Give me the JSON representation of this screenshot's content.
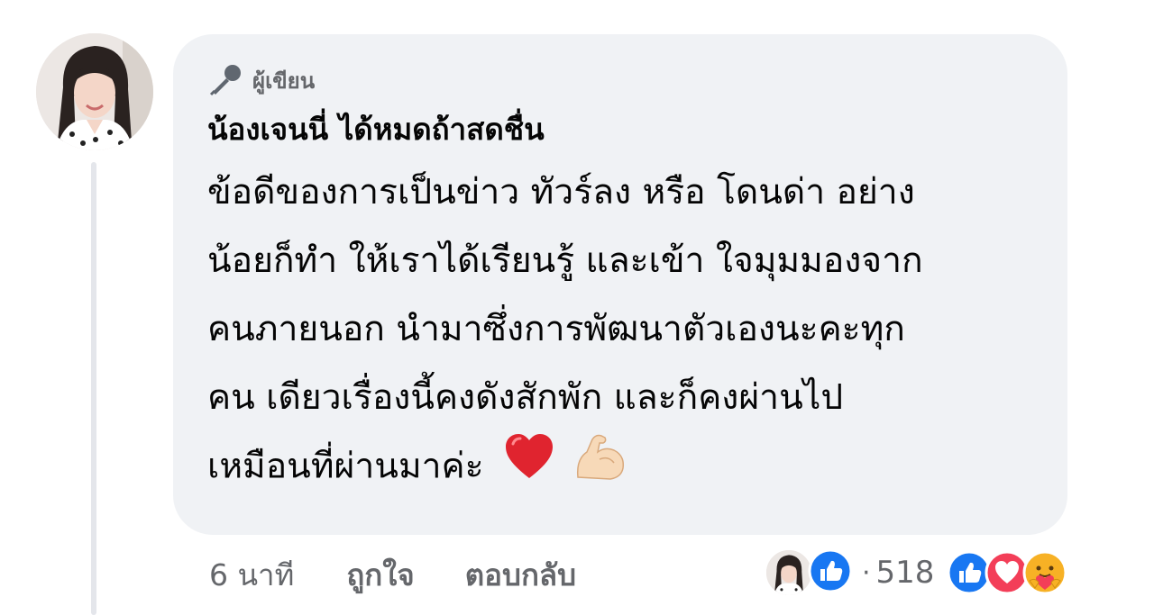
{
  "comment": {
    "badge_label": "ผู้เขียน",
    "badge_icon": "microphone-icon",
    "author_name": "น้องเจนนี่ ได้หมดถ้าสดชื่น",
    "text_lines": [
      "ข้อดีของการเป็นข่าว ทัวร์ลง หรือ โดนด่า อย่าง",
      "น้อยก็ทำ ให้เราได้เรียนรู้ และเข้า ใจมุมมองจาก",
      "คนภายนอก นำมาซึ่งการพัฒนาตัวเองนะคะทุก",
      "คน เดียวเรื่องนี้คงดังสักพัก และก็คงผ่านไป",
      "เหมือนที่ผ่านมาค่ะ"
    ],
    "emojis": [
      "red-heart-emoji",
      "flexed-biceps-emoji"
    ]
  },
  "actions": {
    "time": "6 นาที",
    "like_label": "ถูกใจ",
    "reply_label": "ตอบกลับ"
  },
  "reactions": {
    "count": "518",
    "separator": "·",
    "types": [
      "like-icon",
      "love-icon",
      "care-icon"
    ]
  },
  "colors": {
    "bubble": "#f0f2f5",
    "secondary_text": "#65676b",
    "like_blue": "#1877f2",
    "love_red": "#f33e58",
    "care_yellow": "#f7b125"
  }
}
